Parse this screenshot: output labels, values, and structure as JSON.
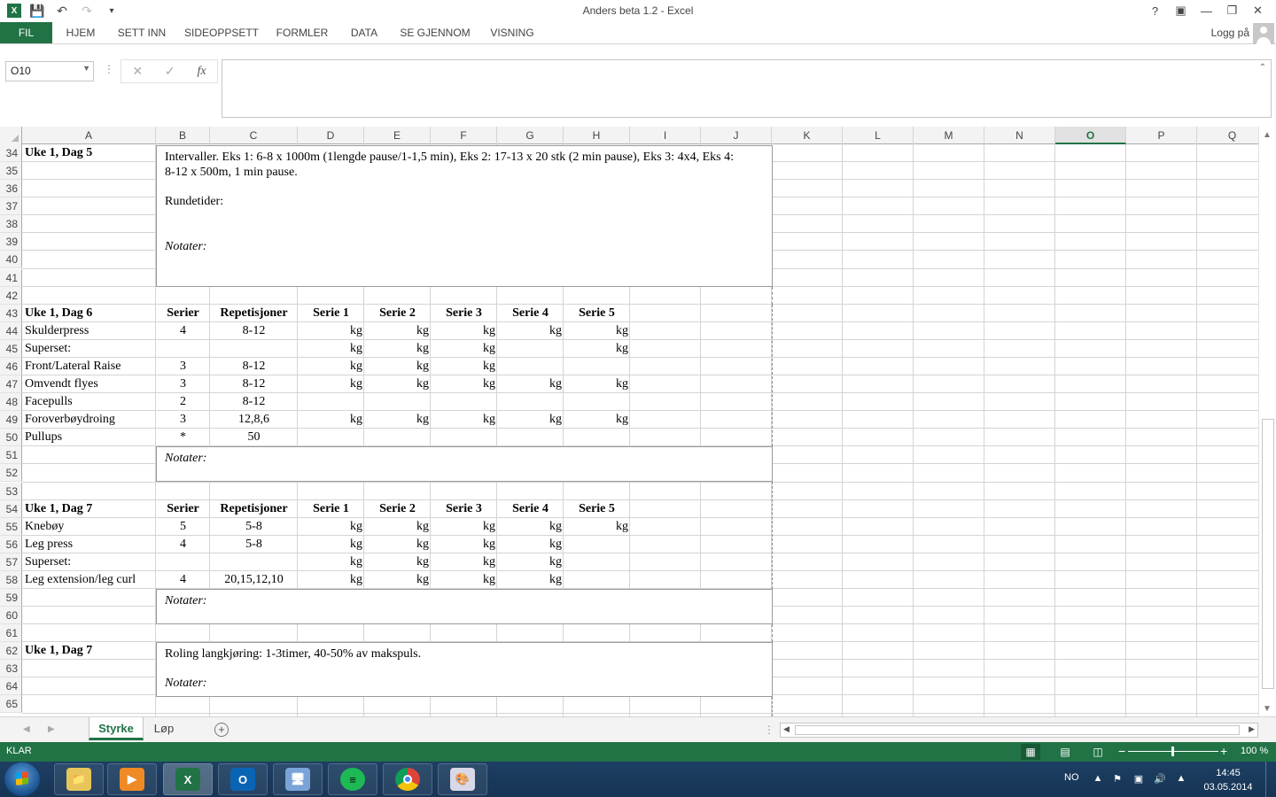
{
  "window": {
    "title": "Anders beta 1.2 - Excel"
  },
  "ribbon": {
    "tabs": [
      "FIL",
      "HJEM",
      "SETT INN",
      "SIDEOPPSETT",
      "FORMLER",
      "DATA",
      "SE GJENNOM",
      "VISNING"
    ],
    "login": "Logg på"
  },
  "formula_bar": {
    "name_box": "O10",
    "fx": "fx",
    "value": ""
  },
  "columns": [
    "A",
    "B",
    "C",
    "D",
    "E",
    "F",
    "G",
    "H",
    "I",
    "J",
    "K",
    "L",
    "M",
    "N",
    "O",
    "P",
    "Q"
  ],
  "selected_column": "O",
  "rows": [
    "34",
    "35",
    "36",
    "37",
    "38",
    "39",
    "40",
    "41",
    "42",
    "43",
    "44",
    "45",
    "46",
    "47",
    "48",
    "49",
    "50",
    "51",
    "52",
    "53",
    "54",
    "55",
    "56",
    "57",
    "58",
    "59",
    "60",
    "61",
    "62",
    "63",
    "64",
    "65"
  ],
  "day5": {
    "title": "Uke 1, Dag 5",
    "line1": "Intervaller. Eks 1: 6-8 x 1000m (1lengde pause/1-1,5 min), Eks 2: 17-13 x 20 stk (2 min pause), Eks 3: 4x4, Eks 4:",
    "line2": "8-12 x 500m, 1 min pause.",
    "rundetider": "Rundetider:",
    "notater": "Notater:"
  },
  "day6": {
    "title": "Uke 1, Dag 6",
    "headers": [
      "Serier",
      "Repetisjoner",
      "Serie 1",
      "Serie 2",
      "Serie 3",
      "Serie 4",
      "Serie 5"
    ],
    "rows": [
      {
        "name": "Skulderpress",
        "serier": "4",
        "reps": "8-12",
        "kg": [
          "kg",
          "kg",
          "kg",
          "kg",
          "kg"
        ]
      },
      {
        "name": "Superset:",
        "serier": "",
        "reps": "",
        "kg": [
          "kg",
          "kg",
          "kg",
          "",
          "kg"
        ]
      },
      {
        "name": "Front/Lateral Raise",
        "serier": "3",
        "reps": "8-12",
        "kg": [
          "kg",
          "kg",
          "kg",
          "",
          ""
        ]
      },
      {
        "name": "Omvendt flyes",
        "serier": "3",
        "reps": "8-12",
        "kg": [
          "kg",
          "kg",
          "kg",
          "kg",
          "kg"
        ]
      },
      {
        "name": "Facepulls",
        "serier": "2",
        "reps": "8-12",
        "kg": [
          "",
          "",
          "",
          "",
          ""
        ]
      },
      {
        "name": "Foroverbøydroing",
        "serier": "3",
        "reps": "12,8,6",
        "kg": [
          "kg",
          "kg",
          "kg",
          "kg",
          "kg"
        ]
      },
      {
        "name": "Pullups",
        "serier": "*",
        "reps": "50",
        "kg": [
          "",
          "",
          "",
          "",
          ""
        ]
      }
    ],
    "notater": "Notater:"
  },
  "day7a": {
    "title": "Uke 1, Dag 7",
    "headers": [
      "Serier",
      "Repetisjoner",
      "Serie 1",
      "Serie 2",
      "Serie 3",
      "Serie 4",
      "Serie 5"
    ],
    "rows": [
      {
        "name": "Knebøy",
        "serier": "5",
        "reps": "5-8",
        "kg": [
          "kg",
          "kg",
          "kg",
          "kg",
          "kg"
        ]
      },
      {
        "name": "Leg press",
        "serier": "4",
        "reps": "5-8",
        "kg": [
          "kg",
          "kg",
          "kg",
          "kg",
          ""
        ]
      },
      {
        "name": "Superset:",
        "serier": "",
        "reps": "",
        "kg": [
          "kg",
          "kg",
          "kg",
          "kg",
          ""
        ]
      },
      {
        "name": "Leg extension/leg curl",
        "serier": "4",
        "reps": "20,15,12,10",
        "kg": [
          "kg",
          "kg",
          "kg",
          "kg",
          ""
        ]
      }
    ],
    "notater": "Notater:"
  },
  "day7b": {
    "title": "Uke 1, Dag 7",
    "line1": "Roling langkjøring: 1-3timer, 40-50% av makspuls.",
    "notater": "Notater:"
  },
  "sheets": {
    "tabs": [
      "Styrke",
      "Løp"
    ],
    "active": "Styrke"
  },
  "status": {
    "text": "KLAR",
    "zoom": "100 %",
    "zoom_fraction": 0.5
  },
  "taskbar": {
    "apps": [
      "explorer-icon",
      "media-player-icon",
      "excel-icon",
      "outlook-icon",
      "network-icon",
      "spotify-icon",
      "chrome-icon",
      "paint-icon"
    ],
    "active_app": "excel-icon",
    "lang": "NO",
    "time": "14:45",
    "date": "03.05.2014"
  },
  "colors": {
    "excel_green": "#217346",
    "taskbar": "#1d3f63"
  }
}
